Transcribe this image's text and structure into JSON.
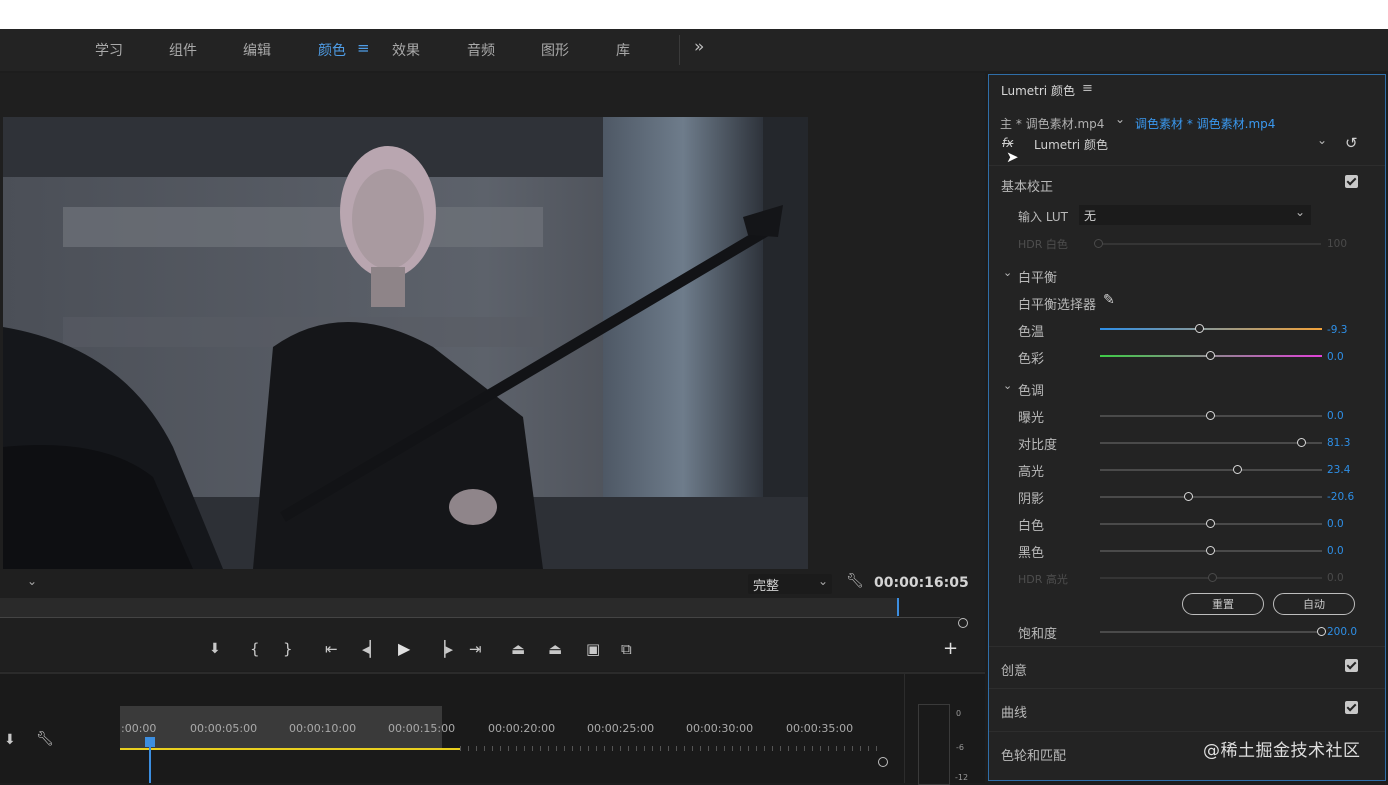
{
  "workspaces": [
    "学习",
    "组件",
    "编辑",
    "颜色",
    "效果",
    "音频",
    "图形",
    "库"
  ],
  "active_workspace": "颜色",
  "monitor": {
    "fit_select": "完整",
    "timecode": "00:00:16:05"
  },
  "timeline": {
    "ruler_labels": [
      ":00:00",
      "00:00:05:00",
      "00:00:10:00",
      "00:00:15:00",
      "00:00:20:00",
      "00:00:25:00",
      "00:00:30:00",
      "00:00:35:00"
    ],
    "meter_labels": [
      "0",
      "-6",
      "-12"
    ],
    "playhead_fraction": 0.09
  },
  "lumetri": {
    "panel_title": "Lumetri 颜色",
    "source_master": "主 * 调色素材.mp4",
    "source_sequence": "调色素材 * 调色素材.mp4",
    "fx_label": "fx",
    "effect_select": "Lumetri 颜色",
    "basic": {
      "title": "基本校正",
      "input_lut_label": "输入 LUT",
      "input_lut_value": "无",
      "hdr_white_label": "HDR 白色",
      "hdr_white_value": "100",
      "white_balance": {
        "title": "白平衡",
        "selector_label": "白平衡选择器",
        "temperature": {
          "label": "色温",
          "value": "-9.3",
          "fraction": 0.45
        },
        "tint": {
          "label": "色彩",
          "value": "0.0",
          "fraction": 0.5
        }
      },
      "tone": {
        "title": "色调",
        "sliders": [
          {
            "label": "曝光",
            "value": "0.0",
            "fraction": 0.5
          },
          {
            "label": "对比度",
            "value": "81.3",
            "fraction": 0.91
          },
          {
            "label": "高光",
            "value": "23.4",
            "fraction": 0.62
          },
          {
            "label": "阴影",
            "value": "-20.6",
            "fraction": 0.4
          },
          {
            "label": "白色",
            "value": "0.0",
            "fraction": 0.5
          },
          {
            "label": "黑色",
            "value": "0.0",
            "fraction": 0.5
          }
        ],
        "hdr_highlight_label": "HDR 高光",
        "hdr_highlight_value": "0.0",
        "reset_label": "重置",
        "auto_label": "自动"
      },
      "saturation": {
        "label": "饱和度",
        "value": "200.0",
        "fraction": 1.0
      }
    },
    "sections": [
      "创意",
      "曲线",
      "色轮和匹配"
    ]
  },
  "watermark": "@稀土掘金技术社区",
  "colors": {
    "accent": "#2e8fe6",
    "panel_border": "#2f6ea8",
    "playhead": "#3c8ee0",
    "in_out_bar": "#e9cf1f"
  }
}
